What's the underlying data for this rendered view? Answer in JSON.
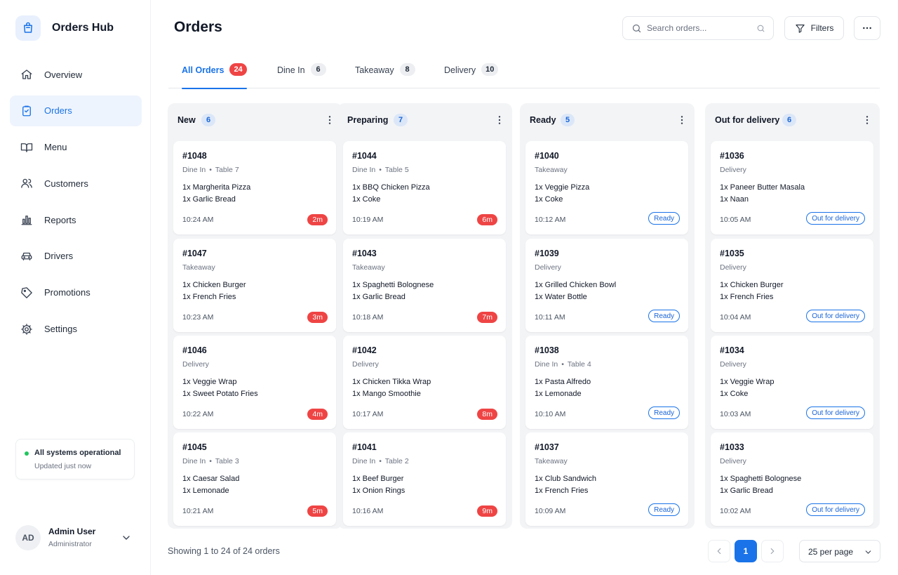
{
  "app": {
    "name": "Orders Hub"
  },
  "sidebar": {
    "items": [
      {
        "label": "Overview",
        "icon": "home-icon"
      },
      {
        "label": "Orders",
        "icon": "clipboard-icon",
        "active": true
      },
      {
        "label": "Menu",
        "icon": "book-open-icon"
      },
      {
        "label": "Customers",
        "icon": "users-icon"
      },
      {
        "label": "Reports",
        "icon": "bar-chart-icon"
      },
      {
        "label": "Drivers",
        "icon": "car-icon"
      },
      {
        "label": "Promotions",
        "icon": "tag-icon"
      },
      {
        "label": "Settings",
        "icon": "gear-icon"
      }
    ],
    "status": {
      "title": "All systems operational",
      "subtitle": "Updated just now",
      "color": "#22c55e"
    },
    "user": {
      "initials": "AD",
      "name": "Admin User",
      "role": "Administrator"
    }
  },
  "header": {
    "title": "Orders",
    "search_placeholder": "Search orders...",
    "filters_label": "Filters"
  },
  "tabs": [
    {
      "label": "All Orders",
      "count": "24",
      "active": true
    },
    {
      "label": "Dine In",
      "count": "6"
    },
    {
      "label": "Takeaway",
      "count": "8"
    },
    {
      "label": "Delivery",
      "count": "10"
    }
  ],
  "columns": [
    {
      "title": "New",
      "count": "6",
      "cards": [
        {
          "id": "#1048",
          "type": "Dine In",
          "table": "Table 7",
          "items": [
            "1x Margherita Pizza",
            "1x Garlic Bread"
          ],
          "time": "10:24 AM",
          "timer": "2m"
        },
        {
          "id": "#1047",
          "type": "Takeaway",
          "items": [
            "1x Chicken Burger",
            "1x French Fries"
          ],
          "time": "10:23 AM",
          "timer": "3m"
        },
        {
          "id": "#1046",
          "type": "Delivery",
          "items": [
            "1x Veggie Wrap",
            "1x Sweet Potato Fries"
          ],
          "time": "10:22 AM",
          "timer": "4m"
        },
        {
          "id": "#1045",
          "type": "Dine In",
          "table": "Table 3",
          "items": [
            "1x Caesar Salad",
            "1x Lemonade"
          ],
          "time": "10:21 AM",
          "timer": "5m"
        }
      ]
    },
    {
      "title": "Preparing",
      "count": "7",
      "cards": [
        {
          "id": "#1044",
          "type": "Dine In",
          "table": "Table 5",
          "items": [
            "1x BBQ Chicken Pizza",
            "1x Coke"
          ],
          "time": "10:19 AM",
          "timer": "6m"
        },
        {
          "id": "#1043",
          "type": "Takeaway",
          "items": [
            "1x Spaghetti Bolognese",
            "1x Garlic Bread"
          ],
          "time": "10:18 AM",
          "timer": "7m"
        },
        {
          "id": "#1042",
          "type": "Delivery",
          "items": [
            "1x Chicken Tikka Wrap",
            "1x Mango Smoothie"
          ],
          "time": "10:17 AM",
          "timer": "8m"
        },
        {
          "id": "#1041",
          "type": "Dine In",
          "table": "Table 2",
          "items": [
            "1x Beef Burger",
            "1x Onion Rings"
          ],
          "time": "10:16 AM",
          "timer": "9m"
        }
      ]
    },
    {
      "title": "Ready",
      "count": "5",
      "cards": [
        {
          "id": "#1040",
          "type": "Takeaway",
          "items": [
            "1x Veggie Pizza",
            "1x Coke"
          ],
          "time": "10:12 AM",
          "status": "Ready"
        },
        {
          "id": "#1039",
          "type": "Delivery",
          "items": [
            "1x Grilled Chicken Bowl",
            "1x Water Bottle"
          ],
          "time": "10:11 AM",
          "status": "Ready"
        },
        {
          "id": "#1038",
          "type": "Dine In",
          "table": "Table 4",
          "items": [
            "1x Pasta Alfredo",
            "1x Lemonade"
          ],
          "time": "10:10 AM",
          "status": "Ready"
        },
        {
          "id": "#1037",
          "type": "Takeaway",
          "items": [
            "1x Club Sandwich",
            "1x French Fries"
          ],
          "time": "10:09 AM",
          "status": "Ready"
        }
      ]
    },
    {
      "title": "Out for delivery",
      "count": "6",
      "cards": [
        {
          "id": "#1036",
          "type": "Delivery",
          "items": [
            "1x Paneer Butter Masala",
            "1x Naan"
          ],
          "time": "10:05 AM",
          "status": "Out for delivery"
        },
        {
          "id": "#1035",
          "type": "Delivery",
          "items": [
            "1x Chicken Burger",
            "1x French Fries"
          ],
          "time": "10:04 AM",
          "status": "Out for delivery"
        },
        {
          "id": "#1034",
          "type": "Delivery",
          "items": [
            "1x Veggie Wrap",
            "1x Coke"
          ],
          "time": "10:03 AM",
          "status": "Out for delivery"
        },
        {
          "id": "#1033",
          "type": "Delivery",
          "items": [
            "1x Spaghetti Bolognese",
            "1x Garlic Bread"
          ],
          "time": "10:02 AM",
          "status": "Out for delivery"
        }
      ]
    }
  ],
  "footer": {
    "showing": "Showing 1 to 24 of 24 orders",
    "current_page": "1",
    "per_page": "25 per page"
  },
  "colors": {
    "accent": "#1a73e8",
    "timer": "#ef4444",
    "column_bg": "#f3f4f6",
    "status_ok": "#22c55e"
  }
}
